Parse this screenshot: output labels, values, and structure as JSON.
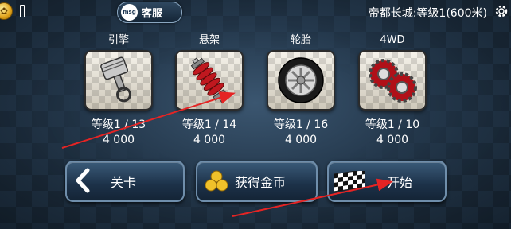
{
  "top_bar": {
    "coin_glyph": "✿",
    "service_icon_text": "msg",
    "service_label": "客服",
    "level_text": "帝都长城:等级1(600米)"
  },
  "parts": [
    {
      "title": "引擎",
      "level": "等级1 / 13",
      "cost": "4 000",
      "icon": "piston-icon"
    },
    {
      "title": "悬架",
      "level": "等级1 / 14",
      "cost": "4 000",
      "icon": "coil-spring-icon"
    },
    {
      "title": "轮胎",
      "level": "等级1 / 16",
      "cost": "4 000",
      "icon": "wheel-icon"
    },
    {
      "title": "4WD",
      "level": "等级1 / 10",
      "cost": "4 000",
      "icon": "gears-icon"
    }
  ],
  "buttons": {
    "back_label": "关卡",
    "coins_label": "获得金币",
    "start_label": "开始"
  },
  "colors": {
    "arrow": "#e52424",
    "accent_red": "#c0181f"
  }
}
